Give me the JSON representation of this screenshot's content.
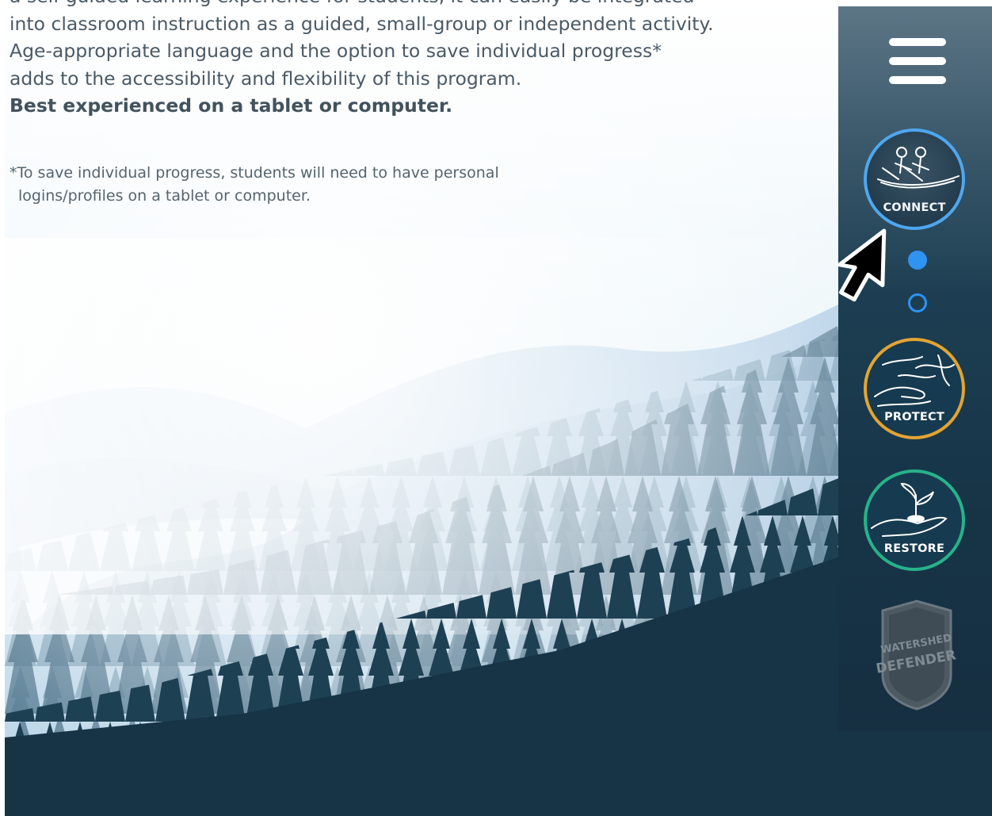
{
  "intro": {
    "lines": [
      "a self-guided learning experience for students, it can easily be integrated",
      "into classroom instruction as a guided, small-group or independent activity.",
      "Age-appropriate language and the option to save individual progress*",
      "adds to the accessibility and flexibility of this program."
    ],
    "bold_line": "Best experienced on a tablet or computer."
  },
  "footnote": {
    "line1": "*To save individual progress, students will need to have personal",
    "line2": "logins/profiles on a tablet or computer."
  },
  "side_nav": {
    "items": [
      {
        "label": "CONNECT",
        "color": "#4ea7ef",
        "icon": "canoe-icon",
        "active": true
      },
      {
        "label": "PROTECT",
        "color": "#e3a433",
        "icon": "hand-river-icon"
      },
      {
        "label": "RESTORE",
        "color": "#26b38a",
        "icon": "seedling-hand-icon"
      }
    ],
    "pagination": {
      "current": 1,
      "total": 2
    },
    "badge": {
      "line1": "WATERSHED",
      "line2": "DEFENDER"
    },
    "menu_icon": "hamburger-icon"
  },
  "colors": {
    "forest_dark": "#163446",
    "nav_bg": "#1d3e52",
    "dot_blue": "#2f93f2"
  }
}
